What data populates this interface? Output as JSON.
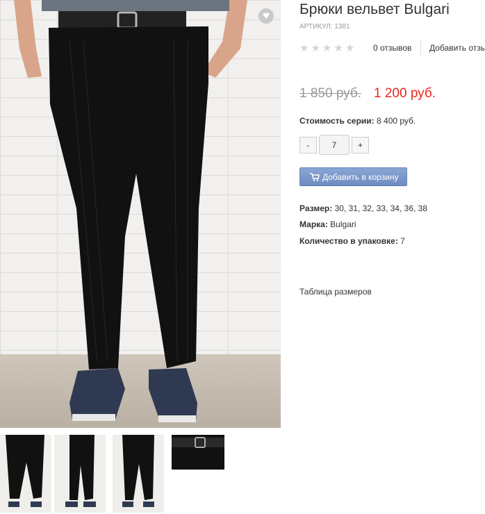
{
  "product": {
    "title": "Брюки вельвет Bulgari",
    "sku": "АРТИКУЛ: 1381",
    "rating_stars": 0,
    "rating_max": 5,
    "reviews_label": "0 отзывов",
    "add_review_label": "Добавить отзыв",
    "price_old": "1 850 руб.",
    "price_new": "1 200 руб.",
    "series_label": "Стоимость серии:",
    "series_value": "8 400 руб.",
    "quantity": {
      "minus": "-",
      "value": "7",
      "plus": "+"
    },
    "add_to_cart_label": "Добавить в корзину",
    "attributes": [
      {
        "label": "Размер:",
        "value": "30, 31, 32, 33, 34, 36, 38"
      },
      {
        "label": "Марка:",
        "value": "Bulgari"
      },
      {
        "label": "Количество в упаковке:",
        "value": "7"
      }
    ],
    "size_table_label": "Таблица размеров"
  },
  "icons": {
    "wishlist": "heart-icon",
    "cart": "cart-icon",
    "rating": "star-icon"
  },
  "colors": {
    "price_new": "#e8261f",
    "price_old": "#999999",
    "button": "#7896c8",
    "star_empty": "#d4d4d4"
  },
  "gallery": {
    "thumbnail_count": 4
  }
}
